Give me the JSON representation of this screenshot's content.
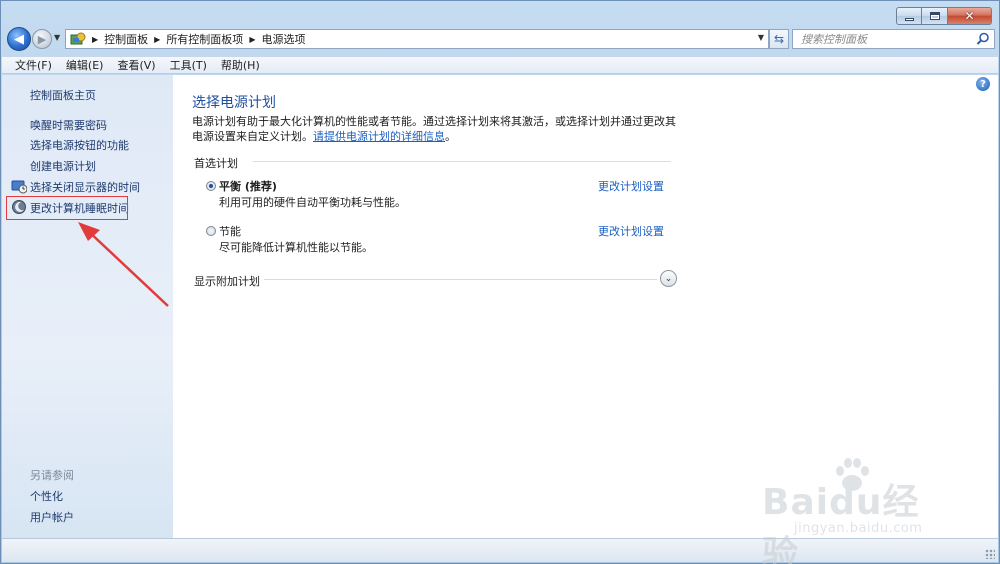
{
  "window": {
    "caption_buttons": [
      "minimize-icon",
      "maximize-icon",
      "close-icon"
    ]
  },
  "nav": {
    "breadcrumbs": [
      "控制面板",
      "所有控制面板项",
      "电源选项"
    ],
    "search_placeholder": "搜索控制面板"
  },
  "menu": {
    "items": [
      "文件(F)",
      "编辑(E)",
      "查看(V)",
      "工具(T)",
      "帮助(H)"
    ]
  },
  "sidebar": {
    "home": "控制面板主页",
    "links": [
      "唤醒时需要密码",
      "选择电源按钮的功能",
      "创建电源计划",
      "选择关闭显示器的时间",
      "更改计算机睡眠时间"
    ],
    "see_also_caption": "另请参阅",
    "see_also": [
      "个性化",
      "用户帐户"
    ]
  },
  "main": {
    "title": "选择电源计划",
    "description": "电源计划有助于最大化计算机的性能或者节能。通过选择计划来将其激活，或选择计划并通过更改其电源设置来自定义计划。",
    "more_info_link": "请提供电源计划的详细信息",
    "description_end": "。",
    "preferred_label": "首选计划",
    "plans": [
      {
        "name": "平衡 (推荐)",
        "desc": "利用可用的硬件自动平衡功耗与性能。",
        "link": "更改计划设置",
        "selected": true
      },
      {
        "name": "节能",
        "desc": "尽可能降低计算机性能以节能。",
        "link": "更改计划设置",
        "selected": false
      }
    ],
    "show_more_label": "显示附加计划"
  },
  "watermark": {
    "brand": "Baidu经验",
    "url": "jingyan.baidu.com"
  },
  "colors": {
    "link": "#1a5fc2",
    "title": "#1f4f9e",
    "annotation": "#e23b3b"
  }
}
